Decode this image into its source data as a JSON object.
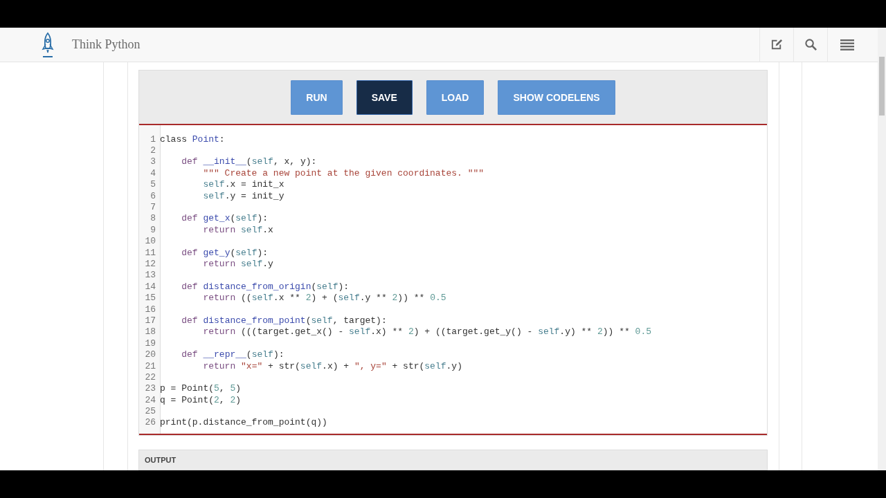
{
  "header": {
    "title": "Think Python"
  },
  "toolbar": {
    "buttons": [
      {
        "label": "RUN",
        "selected": false
      },
      {
        "label": "SAVE",
        "selected": true
      },
      {
        "label": "LOAD",
        "selected": false
      },
      {
        "label": "SHOW CODELENS",
        "selected": false
      }
    ]
  },
  "code": [
    {
      "number": "1",
      "tokens": [
        {
          "kind": "plain",
          "text": "class "
        },
        {
          "kind": "name",
          "text": "Point"
        },
        {
          "kind": "plain",
          "text": ":"
        }
      ]
    },
    {
      "number": "2"
    },
    {
      "number": "3",
      "tokens": [
        {
          "kind": "keyword",
          "text": "    def "
        },
        {
          "kind": "name",
          "text": "__init__"
        },
        {
          "kind": "plain",
          "text": "("
        },
        {
          "kind": "self",
          "text": "self"
        },
        {
          "kind": "plain",
          "text": ", x, y):"
        }
      ]
    },
    {
      "number": "4",
      "tokens": [
        {
          "kind": "string",
          "text": "        \"\"\" Create a new point at the given coordinates. \"\"\""
        }
      ]
    },
    {
      "number": "5",
      "tokens": [
        {
          "kind": "self",
          "text": "        self"
        },
        {
          "kind": "plain",
          "text": ".x = init_x"
        }
      ]
    },
    {
      "number": "6",
      "tokens": [
        {
          "kind": "self",
          "text": "        self"
        },
        {
          "kind": "plain",
          "text": ".y = init_y"
        }
      ]
    },
    {
      "number": "7"
    },
    {
      "number": "8",
      "tokens": [
        {
          "kind": "keyword",
          "text": "    def "
        },
        {
          "kind": "name",
          "text": "get_x"
        },
        {
          "kind": "plain",
          "text": "("
        },
        {
          "kind": "self",
          "text": "self"
        },
        {
          "kind": "plain",
          "text": "):"
        }
      ]
    },
    {
      "number": "9",
      "tokens": [
        {
          "kind": "keyword",
          "text": "        return "
        },
        {
          "kind": "self",
          "text": "self"
        },
        {
          "kind": "plain",
          "text": ".x"
        }
      ]
    },
    {
      "number": "10"
    },
    {
      "number": "11",
      "tokens": [
        {
          "kind": "keyword",
          "text": "    def "
        },
        {
          "kind": "name",
          "text": "get_y"
        },
        {
          "kind": "plain",
          "text": "("
        },
        {
          "kind": "self",
          "text": "self"
        },
        {
          "kind": "plain",
          "text": "):"
        }
      ]
    },
    {
      "number": "12",
      "tokens": [
        {
          "kind": "keyword",
          "text": "        return "
        },
        {
          "kind": "self",
          "text": "self"
        },
        {
          "kind": "plain",
          "text": ".y"
        }
      ]
    },
    {
      "number": "13"
    },
    {
      "number": "14",
      "tokens": [
        {
          "kind": "keyword",
          "text": "    def "
        },
        {
          "kind": "name",
          "text": "distance_from_origin"
        },
        {
          "kind": "plain",
          "text": "("
        },
        {
          "kind": "self",
          "text": "self"
        },
        {
          "kind": "plain",
          "text": "):"
        }
      ]
    },
    {
      "number": "15",
      "tokens": [
        {
          "kind": "keyword",
          "text": "        return"
        },
        {
          "kind": "plain",
          "text": " (("
        },
        {
          "kind": "self",
          "text": "self"
        },
        {
          "kind": "plain",
          "text": ".x ** "
        },
        {
          "kind": "number",
          "text": "2"
        },
        {
          "kind": "plain",
          "text": ") + ("
        },
        {
          "kind": "self",
          "text": "self"
        },
        {
          "kind": "plain",
          "text": ".y ** "
        },
        {
          "kind": "number",
          "text": "2"
        },
        {
          "kind": "plain",
          "text": ")) ** "
        },
        {
          "kind": "number",
          "text": "0.5"
        }
      ]
    },
    {
      "number": "16"
    },
    {
      "number": "17",
      "tokens": [
        {
          "kind": "keyword",
          "text": "    def "
        },
        {
          "kind": "name",
          "text": "distance_from_point"
        },
        {
          "kind": "plain",
          "text": "("
        },
        {
          "kind": "self",
          "text": "self"
        },
        {
          "kind": "plain",
          "text": ", target):"
        }
      ]
    },
    {
      "number": "18",
      "tokens": [
        {
          "kind": "keyword",
          "text": "        return"
        },
        {
          "kind": "plain",
          "text": " (((target.get_x() - "
        },
        {
          "kind": "self",
          "text": "self"
        },
        {
          "kind": "plain",
          "text": ".x) ** "
        },
        {
          "kind": "number",
          "text": "2"
        },
        {
          "kind": "plain",
          "text": ") + ((target.get_y() - "
        },
        {
          "kind": "self",
          "text": "self"
        },
        {
          "kind": "plain",
          "text": ".y) ** "
        },
        {
          "kind": "number",
          "text": "2"
        },
        {
          "kind": "plain",
          "text": ")) ** "
        },
        {
          "kind": "number",
          "text": "0.5"
        }
      ]
    },
    {
      "number": "19"
    },
    {
      "number": "20",
      "tokens": [
        {
          "kind": "keyword",
          "text": "    def "
        },
        {
          "kind": "name",
          "text": "__repr__"
        },
        {
          "kind": "plain",
          "text": "("
        },
        {
          "kind": "self",
          "text": "self"
        },
        {
          "kind": "plain",
          "text": "):"
        }
      ]
    },
    {
      "number": "21",
      "tokens": [
        {
          "kind": "keyword",
          "text": "        return "
        },
        {
          "kind": "string",
          "text": "\"x=\""
        },
        {
          "kind": "plain",
          "text": " + str("
        },
        {
          "kind": "self",
          "text": "self"
        },
        {
          "kind": "plain",
          "text": ".x) + "
        },
        {
          "kind": "string",
          "text": "\", y=\""
        },
        {
          "kind": "plain",
          "text": " + str("
        },
        {
          "kind": "self",
          "text": "self"
        },
        {
          "kind": "plain",
          "text": ".y)"
        }
      ]
    },
    {
      "number": "22"
    },
    {
      "number": "23",
      "tokens": [
        {
          "kind": "plain",
          "text": "p = Point("
        },
        {
          "kind": "number",
          "text": "5"
        },
        {
          "kind": "plain",
          "text": ", "
        },
        {
          "kind": "number",
          "text": "5"
        },
        {
          "kind": "plain",
          "text": ")"
        }
      ]
    },
    {
      "number": "24",
      "tokens": [
        {
          "kind": "plain",
          "text": "q = Point("
        },
        {
          "kind": "number",
          "text": "2"
        },
        {
          "kind": "plain",
          "text": ", "
        },
        {
          "kind": "number",
          "text": "2"
        },
        {
          "kind": "plain",
          "text": ")"
        }
      ]
    },
    {
      "number": "25"
    },
    {
      "number": "26",
      "tokens": [
        {
          "kind": "plain",
          "text": "print(p.distance_from_point(q))"
        }
      ]
    }
  ],
  "output": {
    "heading": "OUTPUT"
  }
}
